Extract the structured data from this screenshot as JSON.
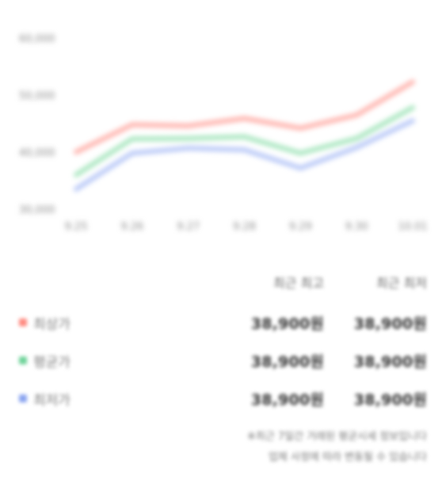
{
  "chart_data": {
    "type": "line",
    "x": [
      "9.25",
      "9.26",
      "9.27",
      "9.28",
      "9.29",
      "9.30",
      "10.01"
    ],
    "y_ticks": [
      "60,000",
      "50,000",
      "40,000",
      "30,000"
    ],
    "ylim": [
      27500,
      62500
    ],
    "series": [
      {
        "name": "최상가",
        "color": "#ffb3ad",
        "values": [
          40000,
          44800,
          44600,
          45900,
          44200,
          46500,
          52300
        ]
      },
      {
        "name": "평균가",
        "color": "#a8e6bf",
        "values": [
          36000,
          42300,
          42400,
          42700,
          39800,
          42400,
          47800
        ]
      },
      {
        "name": "최저가",
        "color": "#b8c8f7",
        "values": [
          33500,
          39800,
          40700,
          40400,
          37200,
          40800,
          45500
        ]
      }
    ],
    "grid": false,
    "legend": "bottom-left"
  },
  "stats": {
    "header_low": "최근 최고",
    "header_high": "최근 최저",
    "rows": [
      {
        "label": "최상가",
        "color": "#ff8a80",
        "v1": "38,900원",
        "v2": "38,900원"
      },
      {
        "label": "평균가",
        "color": "#6fd39a",
        "v1": "38,900원",
        "v2": "38,900원"
      },
      {
        "label": "최저가",
        "color": "#8aa4f0",
        "v1": "38,900원",
        "v2": "38,900원"
      }
    ]
  },
  "notes": {
    "line1": "※최근 7일간 거래된 평균시세 정보입니다",
    "line2": "업체 사정에 따라 변동될 수 있습니다"
  }
}
